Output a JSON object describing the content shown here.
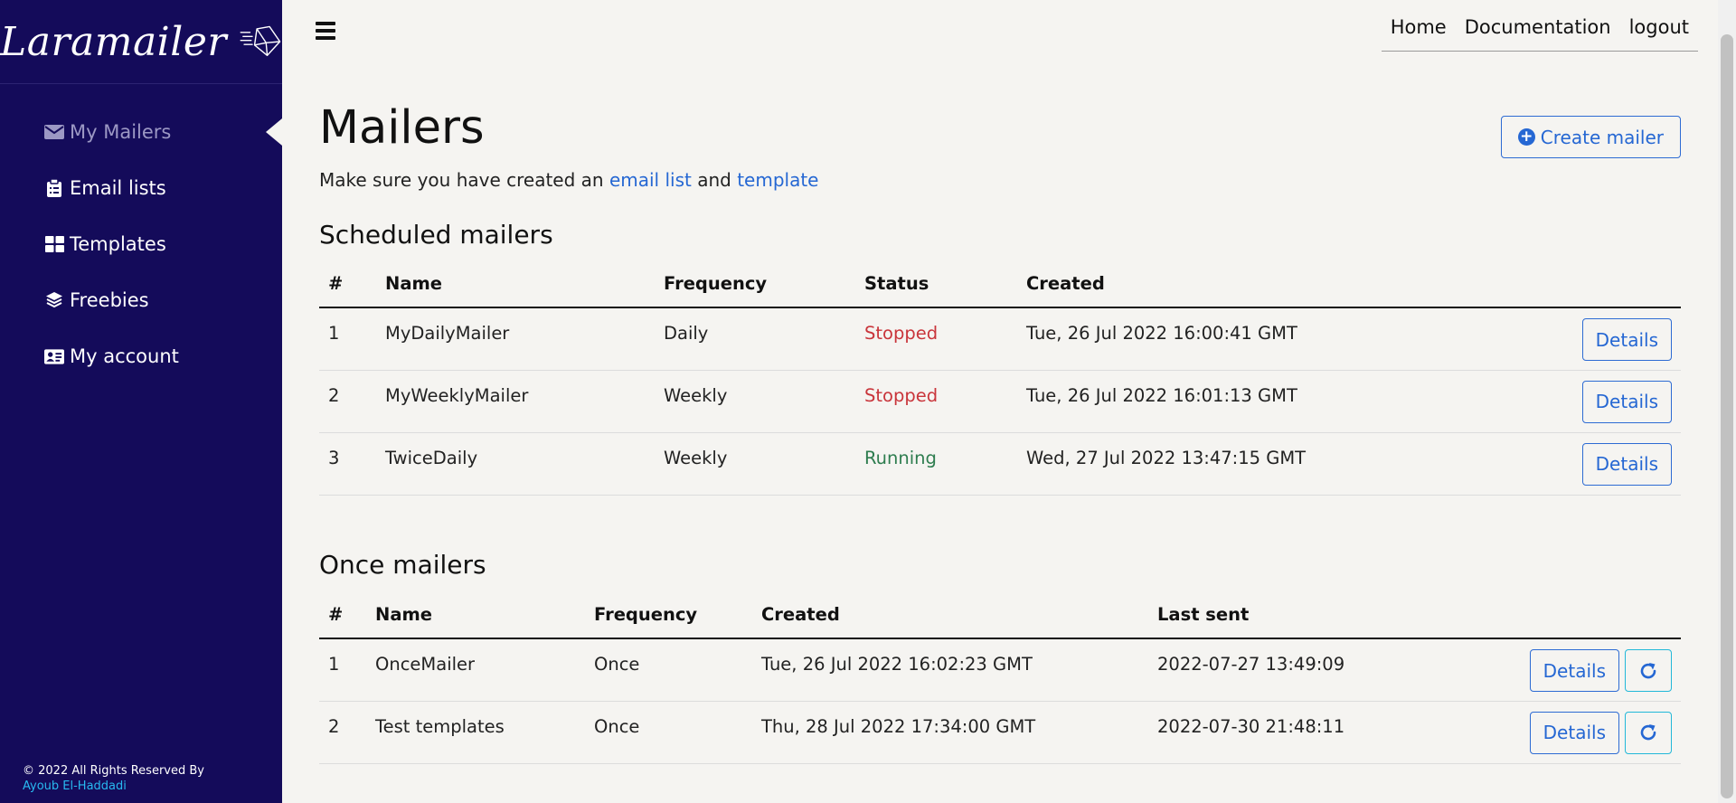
{
  "sidebar": {
    "brand": "Laramailer",
    "items": [
      {
        "label": "My Mailers",
        "icon": "envelope-icon",
        "active": true
      },
      {
        "label": "Email lists",
        "icon": "clipboard-icon",
        "active": false
      },
      {
        "label": "Templates",
        "icon": "grid-icon",
        "active": false
      },
      {
        "label": "Freebies",
        "icon": "layers-icon",
        "active": false
      },
      {
        "label": "My account",
        "icon": "id-card-icon",
        "active": false
      }
    ],
    "footer_text": "© 2022 All Rights Reserved By",
    "footer_author": "Ayoub El-Haddadi"
  },
  "topnav": {
    "home": "Home",
    "documentation": "Documentation",
    "logout": "logout"
  },
  "main": {
    "title": "Mailers",
    "create_button": "Create mailer",
    "hint_prefix": "Make sure you have created an",
    "hint_link1": "email list",
    "hint_middle": "and",
    "hint_link2": "template",
    "scheduled": {
      "title": "Scheduled mailers",
      "headers": [
        "#",
        "Name",
        "Frequency",
        "Status",
        "Created"
      ],
      "rows": [
        {
          "num": "1",
          "name": "MyDailyMailer",
          "frequency": "Daily",
          "status": "Stopped",
          "created": "Tue, 26 Jul 2022 16:00:41 GMT",
          "action": "Details"
        },
        {
          "num": "2",
          "name": "MyWeeklyMailer",
          "frequency": "Weekly",
          "status": "Stopped",
          "created": "Tue, 26 Jul 2022 16:01:13 GMT",
          "action": "Details"
        },
        {
          "num": "3",
          "name": "TwiceDaily",
          "frequency": "Weekly",
          "status": "Running",
          "created": "Wed, 27 Jul 2022 13:47:15 GMT",
          "action": "Details"
        }
      ]
    },
    "once": {
      "title": "Once mailers",
      "headers": [
        "#",
        "Name",
        "Frequency",
        "Created",
        "Last sent"
      ],
      "rows": [
        {
          "num": "1",
          "name": "OnceMailer",
          "frequency": "Once",
          "created": "Tue, 26 Jul 2022 16:02:23 GMT",
          "last_sent": "2022-07-27 13:49:09",
          "action": "Details"
        },
        {
          "num": "2",
          "name": "Test templates",
          "frequency": "Once",
          "created": "Thu, 28 Jul 2022 17:34:00 GMT",
          "last_sent": "2022-07-30 21:48:11",
          "action": "Details"
        }
      ]
    }
  },
  "colors": {
    "sidebar_bg": "#140b5a",
    "accent": "#2567d3",
    "stopped": "#c9353b",
    "running": "#2e7d4f",
    "refresh_border": "#22b8d8"
  }
}
